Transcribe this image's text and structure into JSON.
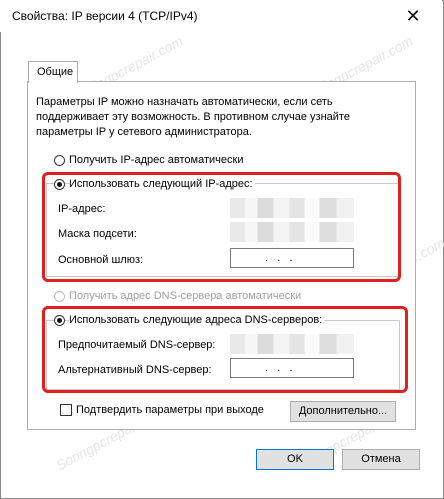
{
  "window": {
    "title": "Свойства: IP версии 4 (TCP/IPv4)",
    "close_glyph": "✕"
  },
  "tabs": [
    {
      "label": "Общие"
    }
  ],
  "description": "Параметры IP можно назначать автоматически, если сеть поддерживает эту возможность. В противном случае узнайте параметры IP у сетевого администратора.",
  "ip_mode": {
    "auto_label": "Получить IP-адрес автоматически",
    "manual_label": "Использовать следующий IP-адрес:",
    "selected": "manual"
  },
  "ip_fields": {
    "ip_label": "IP-адрес:",
    "mask_label": "Маска подсети:",
    "gateway_label": "Основной шлюз:",
    "gateway_value": ".   .   ."
  },
  "dns_mode": {
    "auto_label": "Получить адрес DNS-сервера автоматически",
    "manual_label": "Использовать следующие адреса DNS-серверов:",
    "selected": "manual"
  },
  "dns_fields": {
    "preferred_label": "Предпочитаемый DNS-сервер:",
    "alternate_label": "Альтернативный DNS-сервер:",
    "alternate_value": ".   .   ."
  },
  "validate_label": "Подтвердить параметры при выходе",
  "buttons": {
    "advanced": "Дополнительно...",
    "ok": "OK",
    "cancel": "Отмена"
  },
  "watermark": "Soringpcrepair.com",
  "colors": {
    "highlight": "#e02020",
    "default_button_border": "#0078d7"
  }
}
